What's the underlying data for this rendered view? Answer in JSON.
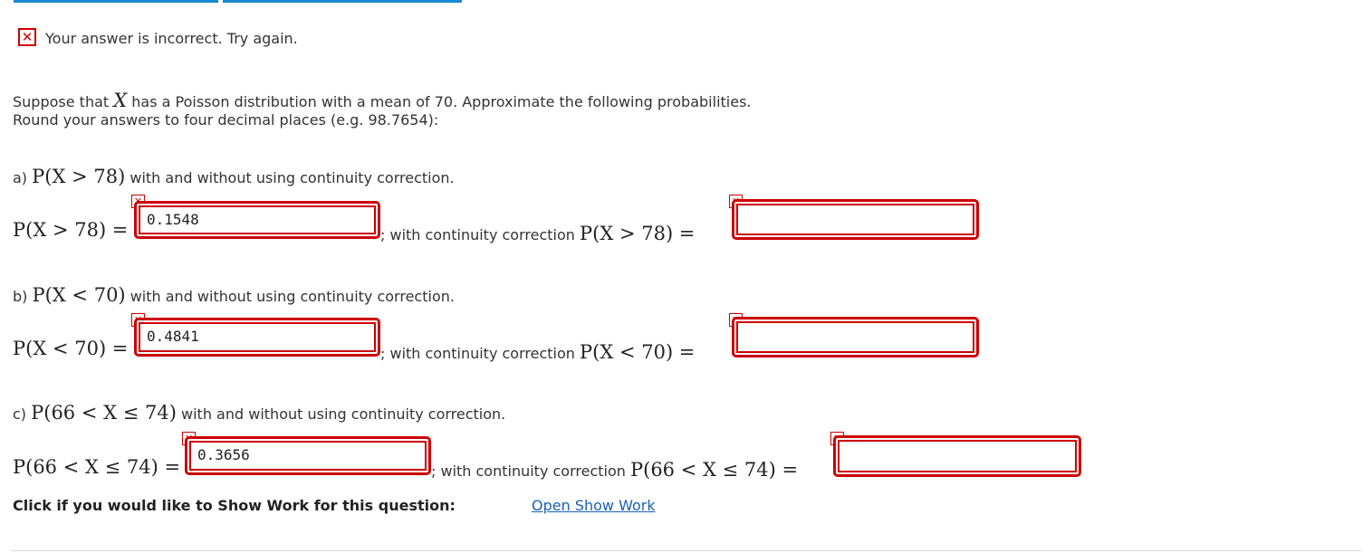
{
  "status": {
    "icon": "x-icon",
    "message": "Your answer is incorrect.  Try again."
  },
  "question": {
    "intro_before": "Suppose that ",
    "var": "X",
    "intro_after": " has a Poisson distribution with a mean of 70. Approximate the following probabilities.",
    "round_note": "Round your answers to four decimal places (e.g. 98.7654):"
  },
  "parts": [
    {
      "prefix": "a) ",
      "expr": "P(X > 78)",
      "desc": " with and without using continuity correction.",
      "lhs": "P(X > 78) =",
      "answer_value": "0.1548",
      "cc_text": "; with continuity correction ",
      "cc_lhs": "P(X > 78) =",
      "cc_value": ""
    },
    {
      "prefix": "b) ",
      "expr": "P(X < 70)",
      "desc": " with and without using continuity correction.",
      "lhs": "P(X < 70) =",
      "answer_value": "0.4841",
      "cc_text": "; with continuity correction ",
      "cc_lhs": "P(X < 70) =",
      "cc_value": ""
    },
    {
      "prefix": "c) ",
      "expr": "P(66 < X ≤ 74)",
      "desc": " with and without using continuity correction.",
      "lhs": "P(66 < X ≤ 74) =",
      "answer_value": "0.3656",
      "cc_text": "; with continuity correction ",
      "cc_lhs": "P(66 < X ≤ 74) =",
      "cc_value": ""
    }
  ],
  "show_work": {
    "prompt": "Click if you would like to Show Work for this question:",
    "link": "Open Show Work"
  },
  "colors": {
    "error": "#cc0000",
    "link": "#1a5fb4",
    "tab_accent": "#1a8ad4"
  }
}
